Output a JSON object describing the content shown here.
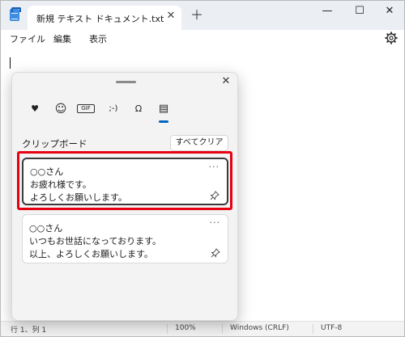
{
  "titlebar": {
    "tab_title": "新規 テキスト ドキュメント.txt",
    "tab_close": "✕",
    "new_tab": "＋",
    "minimize": "—",
    "maximize": "☐",
    "close": "✕"
  },
  "menu": {
    "file": "ファイル",
    "edit": "編集",
    "view": "表示"
  },
  "clipboard": {
    "close": "✕",
    "categories": [
      {
        "name": "sticker",
        "glyph": "♥"
      },
      {
        "name": "emoji",
        "glyph": "☺"
      },
      {
        "name": "gif",
        "glyph": "GIF"
      },
      {
        "name": "kaomoji",
        "glyph": ";-)"
      },
      {
        "name": "symbols",
        "glyph": "Ω"
      },
      {
        "name": "clipboard-history",
        "glyph": "▤"
      }
    ],
    "section_title": "クリップボード",
    "clear_all": "すべてクリア",
    "more": "···",
    "items": [
      {
        "lines": [
          "○○さん",
          "お疲れ様です。",
          "よろしくお願いします。"
        ]
      },
      {
        "lines": [
          "○○さん",
          "いつもお世話になっております。",
          "以上、よろしくお願いします。"
        ]
      }
    ]
  },
  "status": {
    "position": "行 1、列 1",
    "zoom": "100%",
    "line_ending": "Windows (CRLF)",
    "encoding": "UTF-8"
  },
  "colors": {
    "accent": "#0067c0",
    "highlight": "#e60012"
  }
}
